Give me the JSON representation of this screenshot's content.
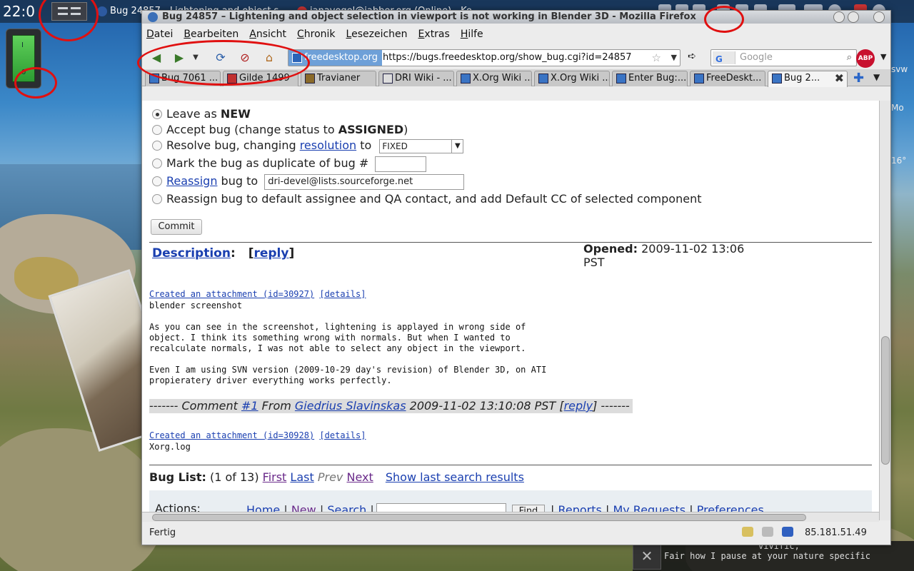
{
  "panel": {
    "clock": "22:0",
    "task1": "Bug 24857 - Lightening and object s",
    "task2": "janavogel@jabber.org (Online) - Ko"
  },
  "widget": {
    "top_label": "I",
    "bottom_label": "0"
  },
  "right_widget": {
    "label1": "svw",
    "label2": "Mo",
    "label3": "16°"
  },
  "chat": {
    "line1": "vivific,",
    "line2": "Fair how I pause at your nature specific",
    "close": "✕"
  },
  "window": {
    "title": "Bug 24857 – Lightening and object selection in viewport is not working in Blender 3D - Mozilla Firefox"
  },
  "menu": [
    "Datei",
    "Bearbeiten",
    "Ansicht",
    "Chronik",
    "Lesezeichen",
    "Extras",
    "Hilfe"
  ],
  "nav": {
    "site_label": "freedesktop.org",
    "url": "https://bugs.freedesktop.org/show_bug.cgi?id=24857",
    "search_placeholder": "Google",
    "search_engine": "G",
    "abp": "ABP"
  },
  "tabs": [
    {
      "label": "Bug 7061 ..."
    },
    {
      "label": "Gilde 1499"
    },
    {
      "label": "Travianer"
    },
    {
      "label": "DRI Wiki - ..."
    },
    {
      "label": "X.Org Wiki ..."
    },
    {
      "label": "X.Org Wiki ..."
    },
    {
      "label": "Enter Bug:..."
    },
    {
      "label": "FreeDeskt..."
    },
    {
      "label": "Bug 2..."
    }
  ],
  "form": {
    "opt1_pre": "Leave as ",
    "opt1_bold": "NEW",
    "opt2_pre": "Accept bug (change status to ",
    "opt2_bold": "ASSIGNED",
    "opt2_post": ")",
    "opt3_pre": "Resolve bug, changing ",
    "opt3_link": "resolution",
    "opt3_post": " to",
    "resolution_value": "FIXED",
    "opt4": "Mark the bug as duplicate of bug #",
    "opt5_link": "Reassign",
    "opt5_post": " bug to",
    "reassign_value": "dri-devel@lists.sourceforge.net",
    "opt6": "Reassign bug to default assignee and QA contact, and add Default CC of selected component",
    "commit": "Commit"
  },
  "description": {
    "label": "Description",
    "colon": ":",
    "reply": "reply",
    "opened_label": "Opened:",
    "opened_value": "2009-11-02 13:06",
    "opened_tz": "PST"
  },
  "attachment1": {
    "link": "Created an attachment (id=30927)",
    "details": "[details]",
    "name": "blender screenshot",
    "body": "As you can see in the screenshot, lightening is applayed in wrong side of\nobject. I think its something wrong with normals. But when I wanted to\nrecalculate normals, I was not able to select any object in the viewport.\n\nEven I am using SVN version (2009-10-29 day's revision) of Blender 3D, on ATI\npropieratery driver everything works perfectly."
  },
  "comment1": {
    "prefix": "------- Comment ",
    "num": "#1",
    "from": " From ",
    "author": "Giedrius Slavinskas",
    "date": " 2009-11-02 13:10:08 PST [",
    "reply": "reply",
    "suffix": "] -------"
  },
  "attachment2": {
    "link": "Created an attachment (id=30928)",
    "details": "[details]",
    "name": "Xorg.log"
  },
  "buglist": {
    "label": "Bug List:",
    "count": " (1 of 13) ",
    "first": "First",
    "last": "Last",
    "prev": "Prev",
    "next": "Next",
    "show_last": "Show last search results"
  },
  "actions": {
    "label": "Actions:",
    "home": "Home",
    "new": "New",
    "search": "Search",
    "find": "Find",
    "reports": "Reports",
    "requests": "My Requests",
    "prefs": "Preferences"
  },
  "status": {
    "text": "Fertig",
    "ip": "85.181.51.49"
  },
  "colors": {
    "annotation": "#e01010",
    "link": "#1a3fb0",
    "site_badge": "#6ea0d8"
  }
}
